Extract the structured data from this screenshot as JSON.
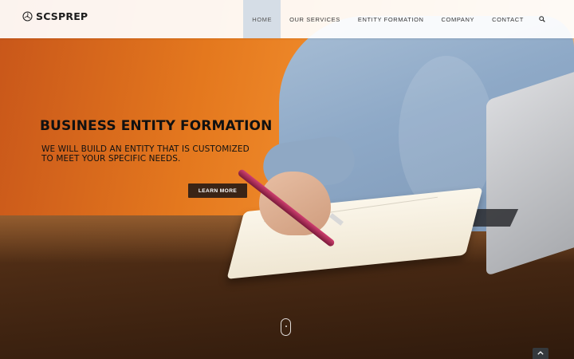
{
  "site": {
    "logo_text": "SCSPREP",
    "logo_icon": "propeller-logo-icon"
  },
  "nav": {
    "items": [
      {
        "label": "HOME",
        "active": true
      },
      {
        "label": "OUR SERVICES",
        "active": false
      },
      {
        "label": "ENTITY FORMATION",
        "active": false
      },
      {
        "label": "COMPANY",
        "active": false
      },
      {
        "label": "CONTACT",
        "active": false
      }
    ],
    "search_icon": "search-icon",
    "active_bg": "#d5dde6"
  },
  "hero": {
    "title": "BUSINESS ENTITY FORMATION",
    "subtitle": "WE WILL BUILD AN ENTITY THAT IS CUSTOMIZED TO MEET YOUR SPECIFIC NEEDS.",
    "button_label": "LEARN MORE",
    "button_color": "#3a2416",
    "accent_color": "#ef8a2a"
  },
  "controls": {
    "scroll_icon": "mouse-scroll-icon",
    "back_to_top_icon": "chevron-up-icon"
  }
}
